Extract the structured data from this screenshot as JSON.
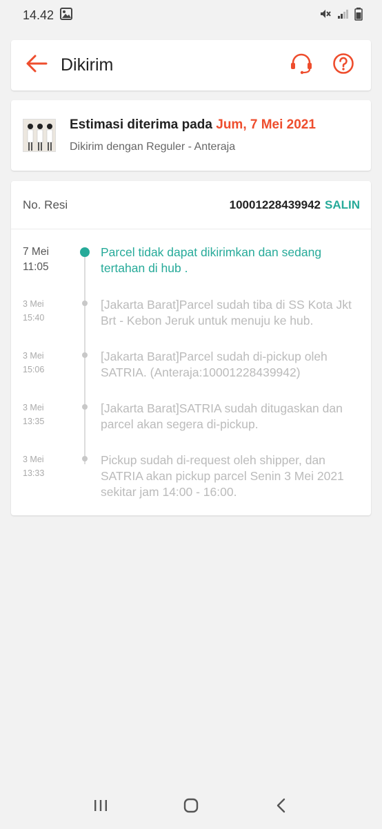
{
  "status_bar": {
    "time": "14.42",
    "icon_names": [
      "gallery-icon",
      "mute-icon",
      "signal-icon",
      "battery-icon"
    ]
  },
  "header": {
    "title": "Dikirim",
    "back_icon": "back-arrow-icon",
    "support_icon": "headset-icon",
    "help_icon": "help-icon"
  },
  "estimate": {
    "prefix": "Estimasi diterima pada",
    "date": "Jum, 7 Mei 2021",
    "shipping": "Dikirim dengan Reguler - Anteraja"
  },
  "resi": {
    "label": "No. Resi",
    "number": "10001228439942",
    "copy_label": "SALIN"
  },
  "timeline": [
    {
      "date": "7 Mei",
      "time": "11:05",
      "text": "Parcel tidak dapat dikirimkan dan sedang tertahan di hub .",
      "active": true
    },
    {
      "date": "3 Mei",
      "time": "15:40",
      "text": "[Jakarta Barat]Parcel sudah tiba di SS Kota Jkt Brt - Kebon Jeruk untuk menuju ke hub.",
      "active": false
    },
    {
      "date": "3 Mei",
      "time": "15:06",
      "text": "[Jakarta Barat]Parcel sudah di-pickup oleh SATRIA. (Anteraja:10001228439942)",
      "active": false
    },
    {
      "date": "3 Mei",
      "time": "13:35",
      "text": "[Jakarta Barat]SATRIA sudah ditugaskan dan parcel akan segera di-pickup.",
      "active": false
    },
    {
      "date": "3 Mei",
      "time": "13:33",
      "text": "Pickup sudah di-request oleh shipper, dan SATRIA akan pickup parcel Senin 3 Mei 2021 sekitar jam 14:00 - 16:00.",
      "active": false
    }
  ],
  "colors": {
    "accent": "#ee4d2d",
    "teal": "#26aa99",
    "muted": "#bbbbbb"
  },
  "nav_bar": {
    "icons": [
      "recent-apps-icon",
      "home-icon",
      "back-icon"
    ]
  }
}
